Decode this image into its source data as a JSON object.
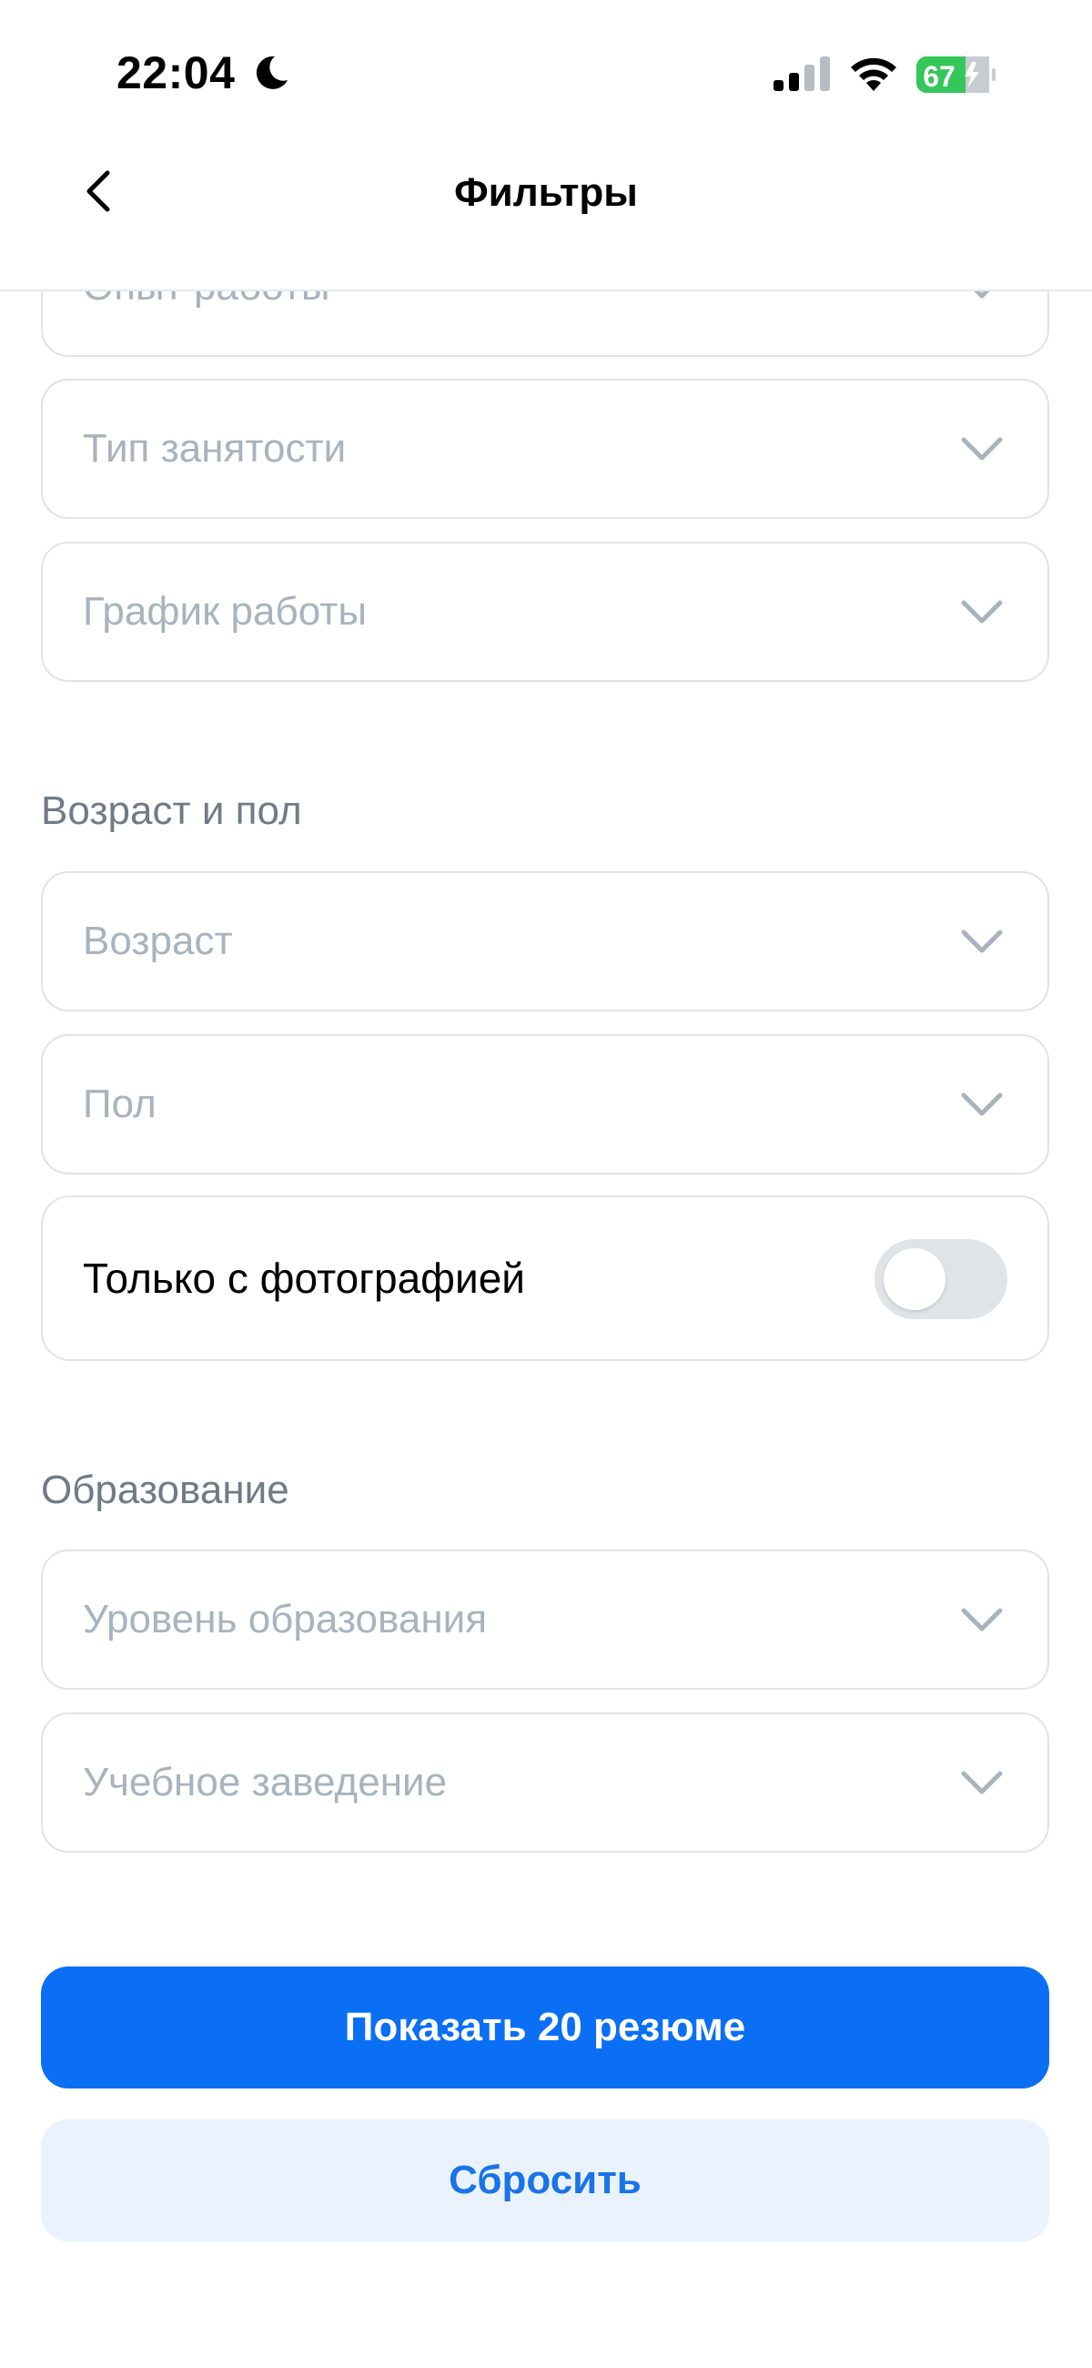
{
  "status": {
    "time": "22:04",
    "battery_level": "67"
  },
  "nav": {
    "title": "Фильтры"
  },
  "work": {
    "experience_placeholder": "Опыт работы",
    "employment_type_placeholder": "Тип занятости",
    "schedule_placeholder": "График работы"
  },
  "age_gender": {
    "section_title": "Возраст и пол",
    "age_placeholder": "Возраст",
    "gender_placeholder": "Пол",
    "photo_only_label": "Только с фотографией",
    "photo_only_enabled": false
  },
  "education": {
    "section_title": "Образование",
    "level_placeholder": "Уровень образования",
    "institution_placeholder": "Учебное заведение"
  },
  "actions": {
    "show_label": "Показать 20 резюме",
    "reset_label": "Сбросить"
  },
  "colors": {
    "accent": "#0a6ff5",
    "secondary_bg": "#eaf3fd",
    "border": "#dfe4e8",
    "placeholder": "#a8b3bd",
    "battery_green": "#34c759"
  }
}
